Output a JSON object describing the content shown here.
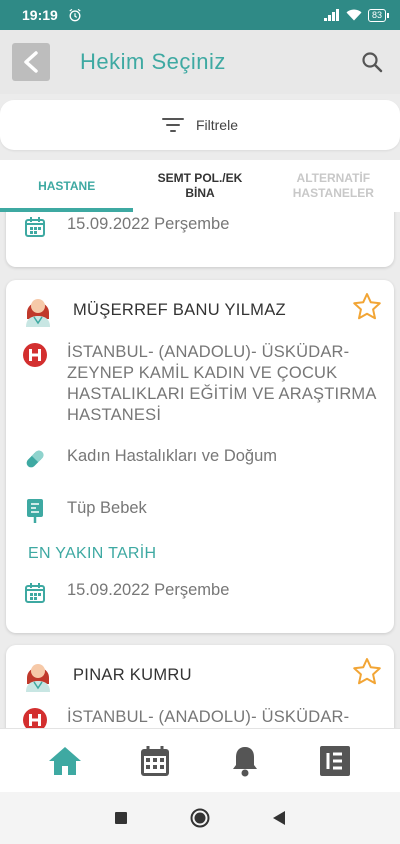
{
  "status_bar": {
    "time": "19:19",
    "battery": "83"
  },
  "app_bar": {
    "title": "Hekim Seçiniz"
  },
  "filter": {
    "label": "Filtrele"
  },
  "tabs": [
    {
      "label": "HASTANE",
      "state": "active"
    },
    {
      "label": "SEMT POL./EK BİNA",
      "state": "normal"
    },
    {
      "label": "ALTERNATİF HASTANELER",
      "state": "disabled"
    }
  ],
  "doctors": [
    {
      "date": "15.09.2022 Perşembe"
    },
    {
      "name": "MÜŞERREF BANU YILMAZ",
      "hospital": "İSTANBUL- (ANADOLU)- ÜSKÜDAR- ZEYNEP KAMİL KADIN VE ÇOCUK HASTALIKLARI EĞİTİM VE ARAŞTIRMA HASTANESİ",
      "department": "Kadın Hastalıkları ve Doğum",
      "subspecialty": "Tüp Bebek",
      "nearest_label": "EN YAKIN TARİH",
      "date": "15.09.2022 Perşembe"
    },
    {
      "name": "PINAR KUMRU",
      "hospital": "İSTANBUL- (ANADOLU)- ÜSKÜDAR-"
    }
  ],
  "bottom_nav": [
    "home-icon",
    "calendar-icon",
    "bell-icon",
    "list-icon"
  ],
  "colors": {
    "accent": "#3ea9a2",
    "status_bar": "#2f8a86",
    "hospital_red": "#d32f2f",
    "star": "#f2a535"
  }
}
